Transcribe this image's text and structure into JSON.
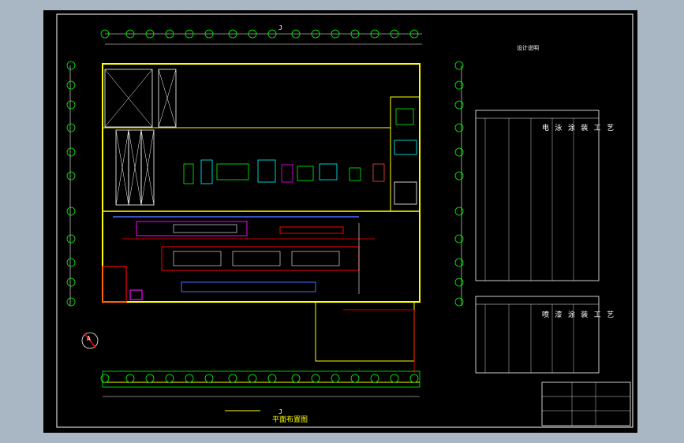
{
  "drawing": {
    "notes_title": "设计说明",
    "table1_title": "电 泳 涂 装 工 艺",
    "table2_title": "喷 漆 涂 装 工 艺",
    "plan_title": "平面布置图",
    "grid_top_label": "J",
    "grid_bottom_label": "J",
    "section_symbol_label": "A"
  },
  "colors": {
    "canvas": "#000000",
    "frame": "#ffffff",
    "wall": "#ffff00",
    "grid": "#00ff00",
    "dim": "#00ffff",
    "equipment_red": "#ff0000",
    "equipment_magenta": "#ff00ff",
    "equipment_blue": "#4d6cff",
    "outer_bg": "#a9b7c4"
  }
}
